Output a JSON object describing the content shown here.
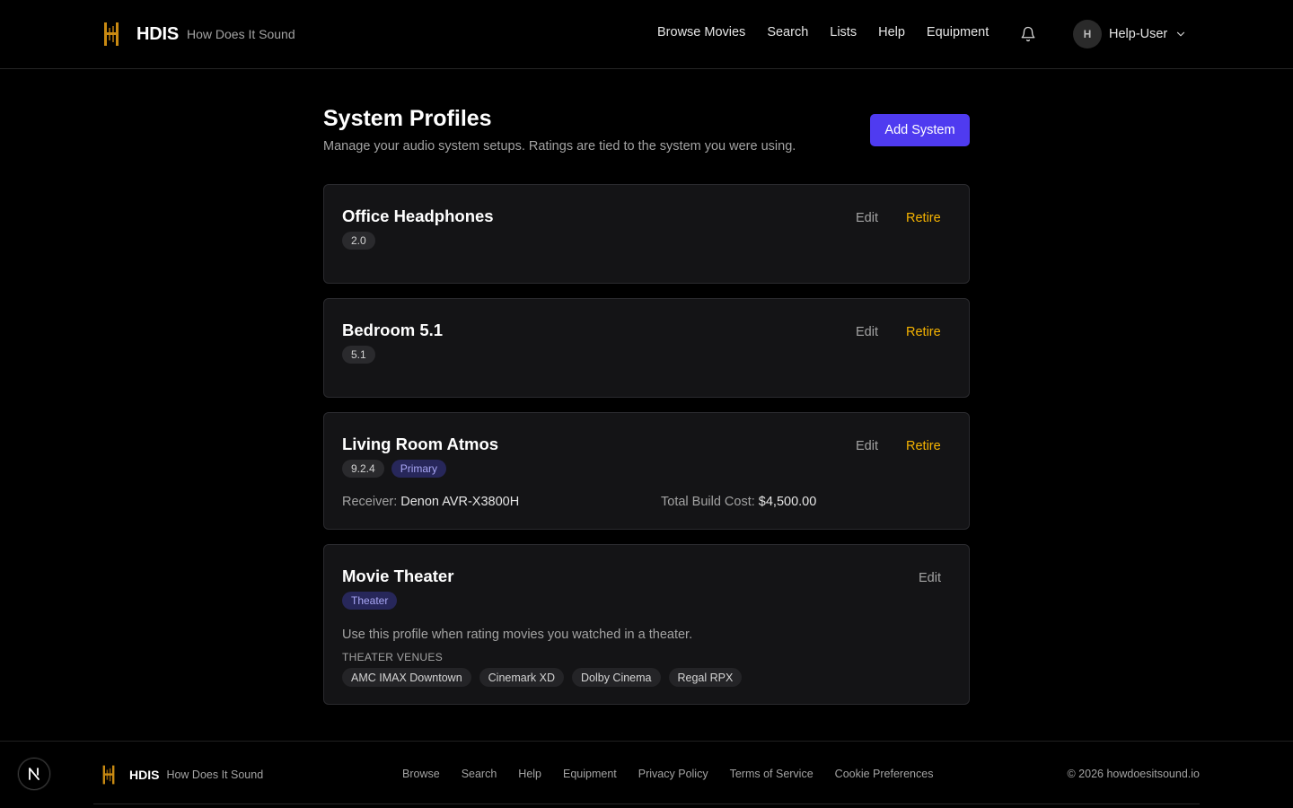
{
  "header": {
    "brand_name": "HDIS",
    "brand_tag": "How Does It Sound",
    "nav": [
      "Browse Movies",
      "Search",
      "Lists",
      "Help",
      "Equipment"
    ],
    "user_initial": "H",
    "user_name": "Help-User"
  },
  "page": {
    "title": "System Profiles",
    "subtitle": "Manage your audio system setups. Ratings are tied to the system you were using.",
    "add_label": "Add System"
  },
  "actions": {
    "edit": "Edit",
    "retire": "Retire"
  },
  "systems": [
    {
      "name": "Office Headphones",
      "badges": [
        "2.0"
      ]
    },
    {
      "name": "Bedroom 5.1",
      "badges": [
        "5.1"
      ]
    },
    {
      "name": "Living Room Atmos",
      "badges": [
        "9.2.4",
        "Primary"
      ],
      "receiver_label": "Receiver:",
      "receiver_value": "Denon AVR-X3800H",
      "cost_label": "Total Build Cost:",
      "cost_value": "$4,500.00"
    },
    {
      "name": "Movie Theater",
      "badges": [
        "Theater"
      ],
      "description": "Use this profile when rating movies you watched in a theater.",
      "venues_label": "THEATER VENUES",
      "venues": [
        "AMC IMAX Downtown",
        "Cinemark XD",
        "Dolby Cinema",
        "Regal RPX"
      ]
    }
  ],
  "footer": {
    "brand_name": "HDIS",
    "brand_tag": "How Does It Sound",
    "links": [
      "Browse",
      "Search",
      "Help",
      "Equipment",
      "Privacy Policy",
      "Terms of Service",
      "Cookie Preferences"
    ],
    "copyright": "© 2026 howdoesitsound.io"
  },
  "colors": {
    "accent": "#4f3bf0",
    "retire": "#f5b301",
    "logo_gold": "#c98a12"
  },
  "icons": [
    "brand-logo-icon",
    "bell-icon",
    "chevron-down-icon",
    "next-logo-icon"
  ]
}
